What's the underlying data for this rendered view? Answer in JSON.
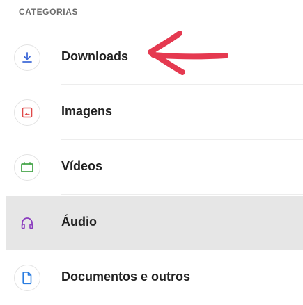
{
  "header": {
    "title": "CATEGORIAS"
  },
  "categories": [
    {
      "label": "Downloads",
      "icon": "download-icon",
      "color": "#3f6ad8"
    },
    {
      "label": "Imagens",
      "icon": "image-icon",
      "color": "#e04848"
    },
    {
      "label": "Vídeos",
      "icon": "video-icon",
      "color": "#46a54a"
    },
    {
      "label": "Áudio",
      "icon": "headphones-icon",
      "color": "#8b3dbf"
    },
    {
      "label": "Documentos e outros",
      "icon": "document-icon",
      "color": "#2a7de1"
    }
  ],
  "selected_index": 3,
  "annotation": {
    "color": "#e53950"
  }
}
